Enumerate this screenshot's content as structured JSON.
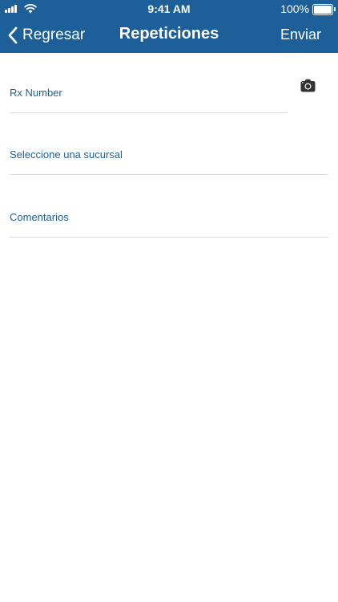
{
  "status_bar": {
    "time": "9:41 AM",
    "battery": "100%"
  },
  "nav": {
    "back_label": "Regresar",
    "title": "Repeticiones",
    "action_label": "Enviar"
  },
  "form": {
    "rx_number": {
      "label": "Rx Number",
      "value": ""
    },
    "branch": {
      "label": "Seleccione una sucursal",
      "value": ""
    },
    "comments": {
      "label": "Comentarios",
      "value": ""
    }
  },
  "icons": {
    "camera": "camera-icon",
    "back": "chevron-left-icon"
  },
  "colors": {
    "nav_background": "#1d5f98",
    "label": "#1d5f98",
    "divider": "#d8d8d8"
  }
}
